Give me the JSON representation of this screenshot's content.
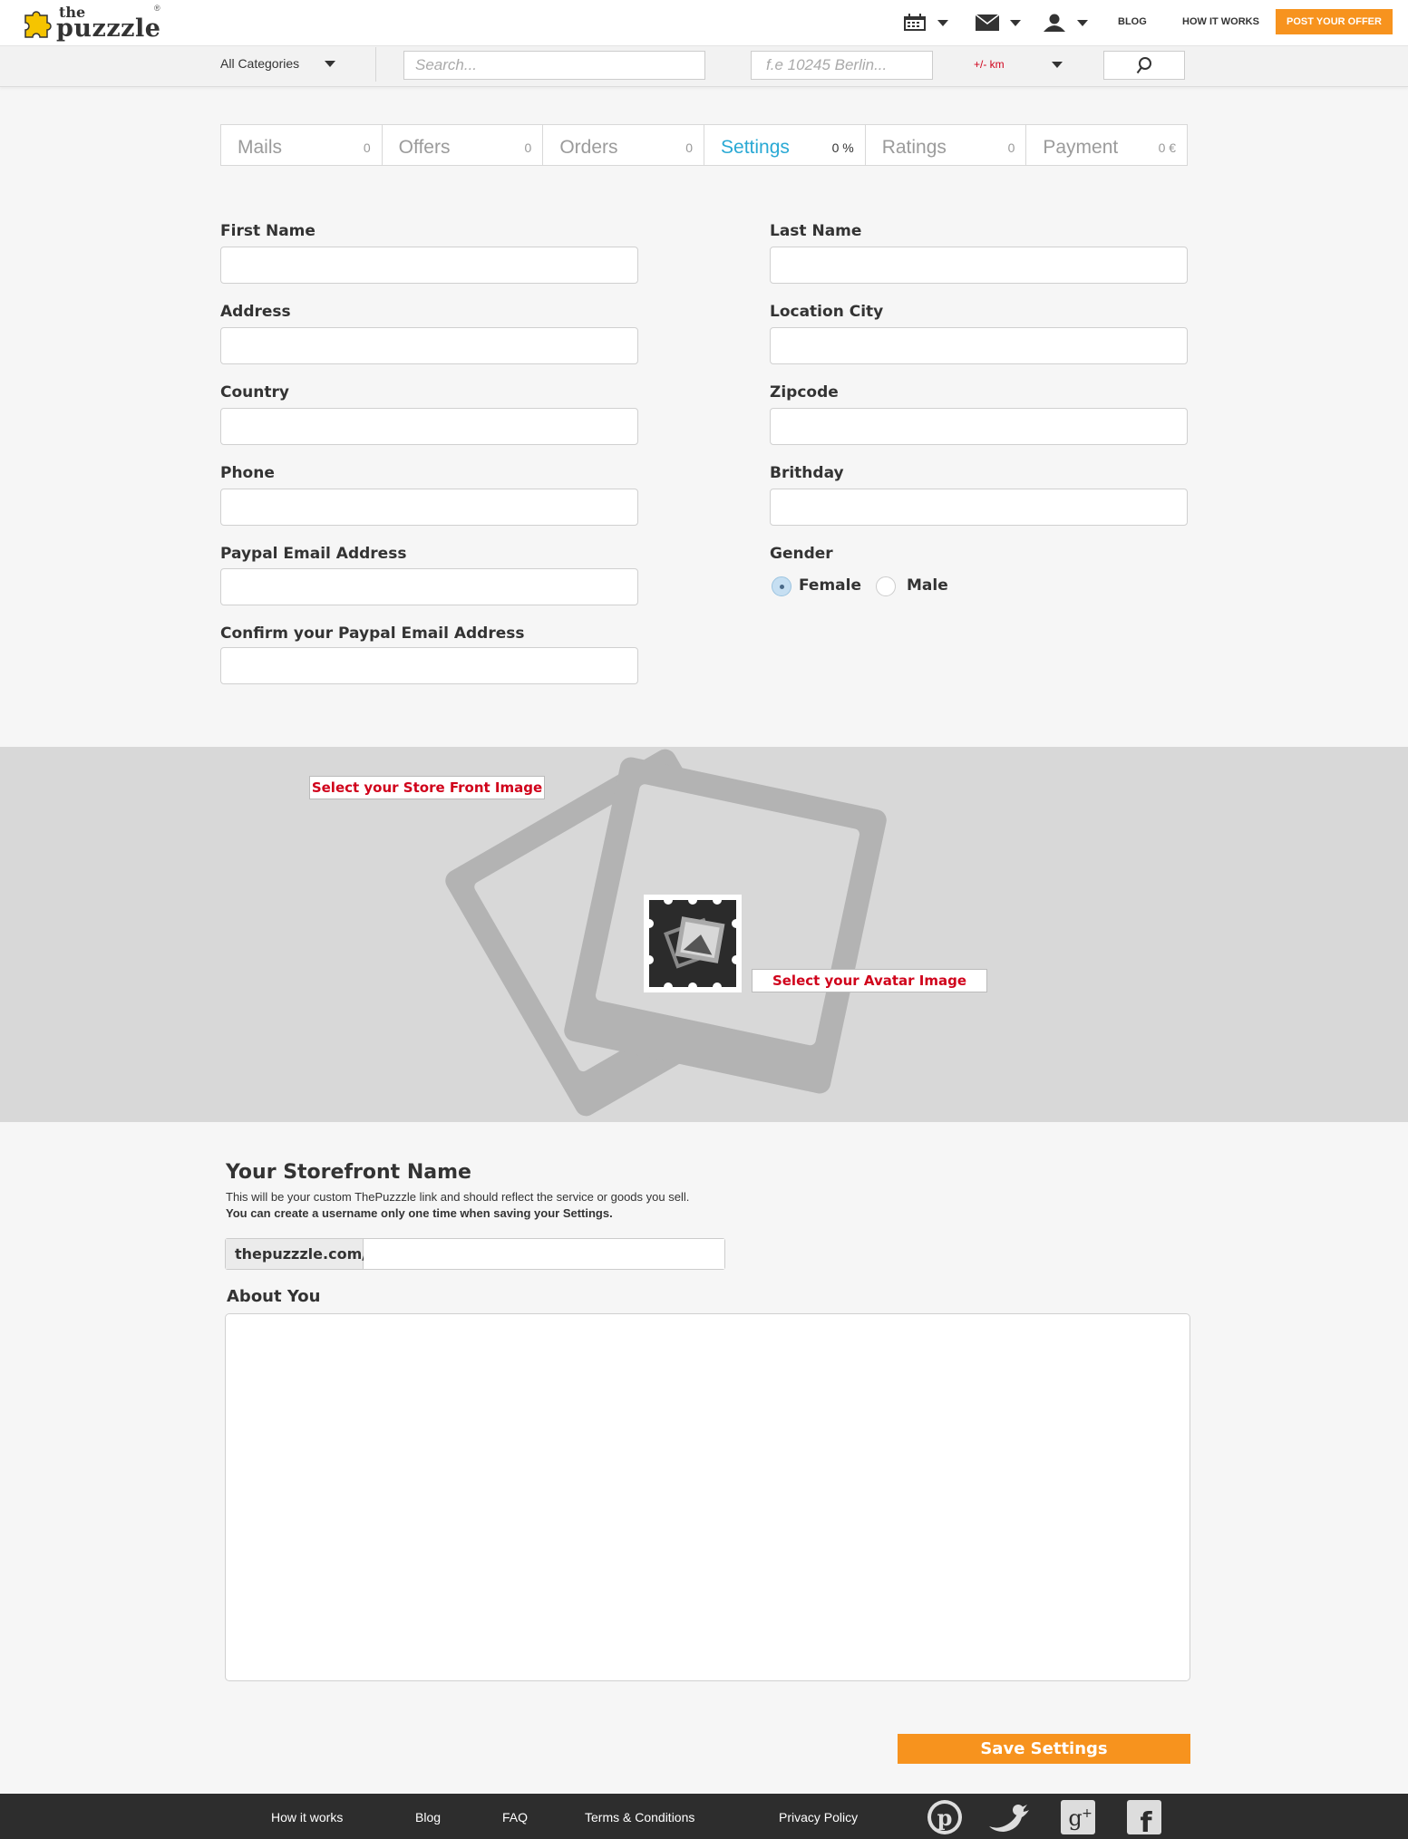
{
  "header": {
    "logo_the": "the",
    "logo_name": "puzzzle",
    "logo_reg": "®",
    "nav": {
      "blog": "BLOG",
      "how_it_works": "HOW IT WORKS"
    },
    "post_button": "POST YOUR OFFER"
  },
  "search": {
    "category": "All Categories",
    "placeholder": "Search...",
    "location_placeholder": "f.e 10245 Berlin...",
    "radius": "+/- km"
  },
  "tabs": [
    {
      "label": "Mails",
      "count": "0"
    },
    {
      "label": "Offers",
      "count": "0"
    },
    {
      "label": "Orders",
      "count": "0"
    },
    {
      "label": "Settings",
      "count": "0 %"
    },
    {
      "label": "Ratings",
      "count": "0"
    },
    {
      "label": "Payment",
      "count": "0 €"
    }
  ],
  "form": {
    "first_name": "First Name",
    "last_name": "Last Name",
    "address": "Address",
    "location_city": "Location City",
    "country": "Country",
    "zipcode": "Zipcode",
    "phone": "Phone",
    "birthday": "Brithday",
    "paypal": "Paypal Email Address",
    "gender": "Gender",
    "female": "Female",
    "male": "Male",
    "confirm_paypal": "Confirm your Paypal Email Address"
  },
  "images": {
    "store_front": "Select your Store Front Image",
    "avatar": "Select your Avatar Image"
  },
  "storefront": {
    "title": "Your Storefront Name",
    "desc": "This will be your custom ThePuzzzle link and should reflect the service or goods you sell.",
    "desc_bold": "You can create a username only one time when saving your Settings.",
    "url_prefix": "thepuzzzle.com/",
    "about": "About You"
  },
  "save_button": "Save Settings",
  "footer": {
    "how_it_works": "How it works",
    "blog": "Blog",
    "faq": "FAQ",
    "terms": "Terms & Conditions",
    "privacy": "Privacy Policy"
  },
  "colors": {
    "accent_orange": "#f7931e",
    "active_tab": "#29a9d4",
    "red_text": "#d0021b",
    "logo_yellow": "#f5c400"
  }
}
